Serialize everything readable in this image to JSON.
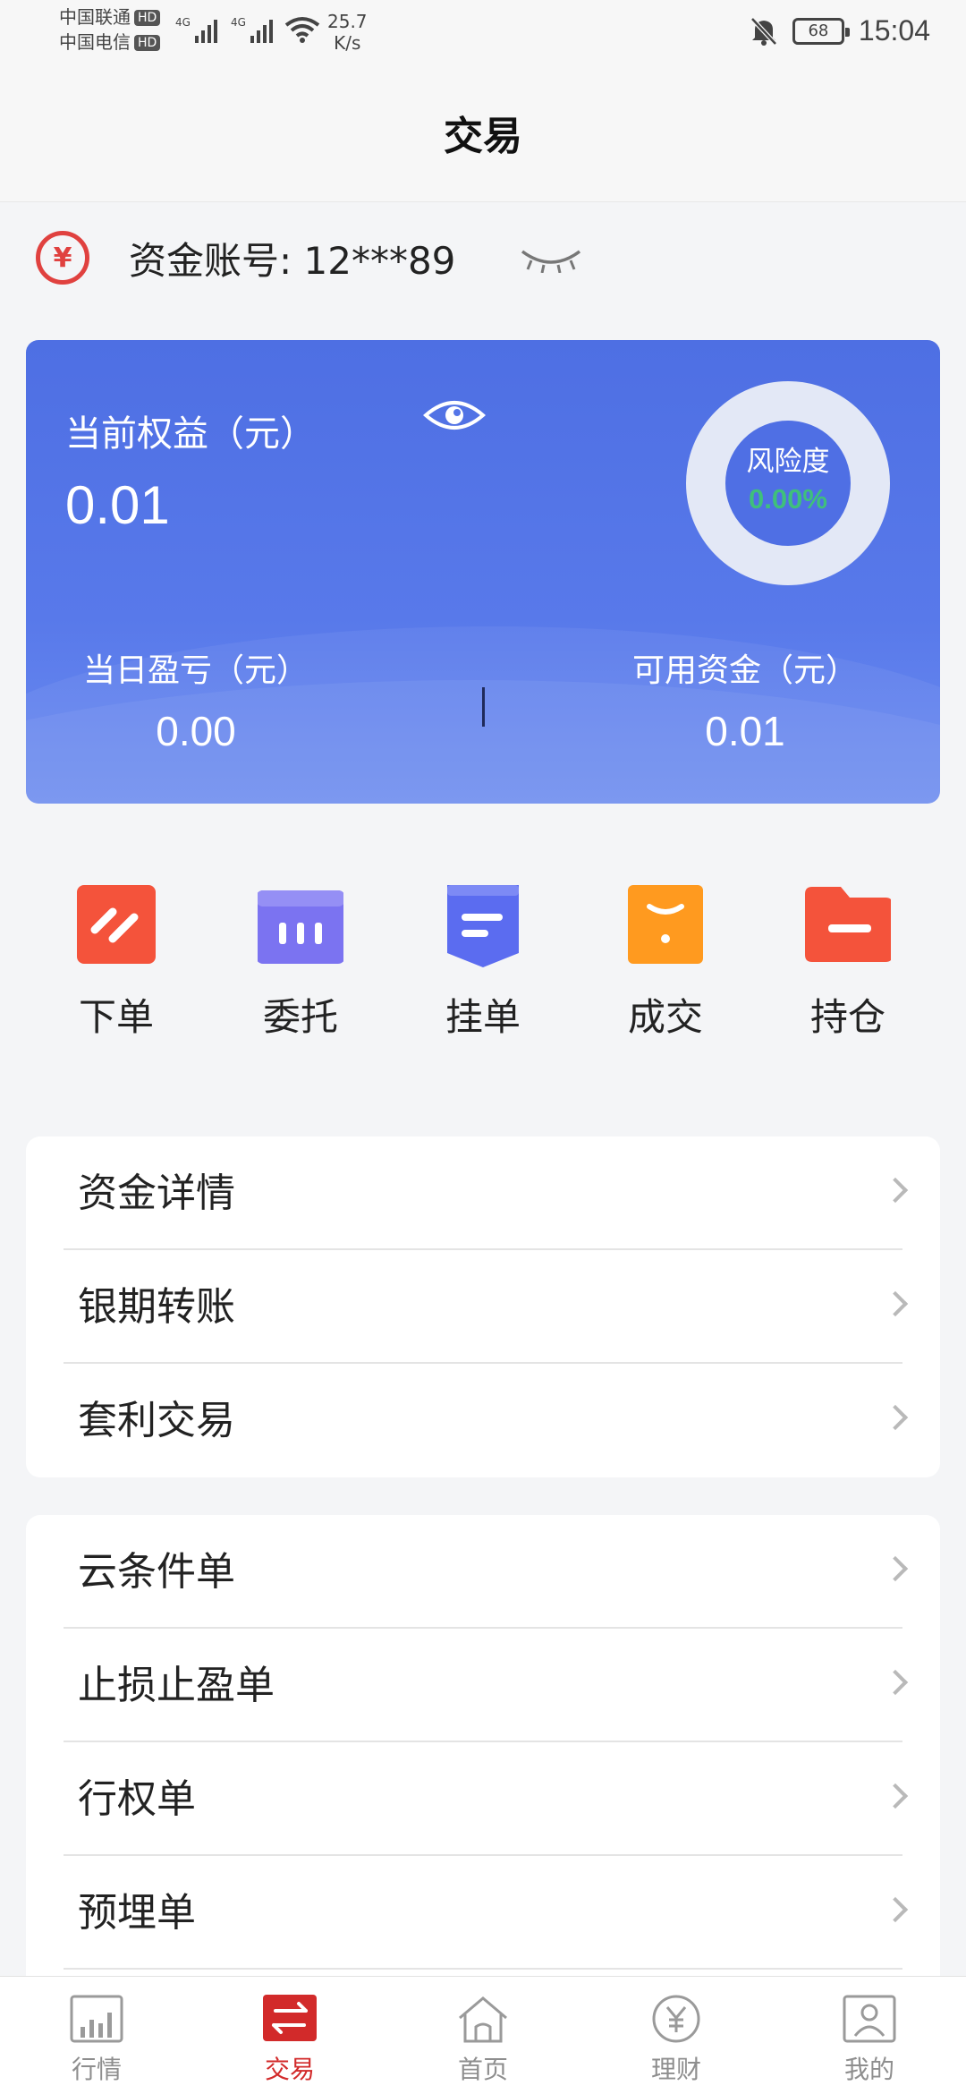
{
  "status_bar": {
    "carrier1": "中国联通",
    "carrier2": "中国电信",
    "hd": "HD",
    "net_label": "4G",
    "speed_value": "25.7",
    "speed_unit": "K/s",
    "battery": "68",
    "time": "15:04"
  },
  "header": {
    "title": "交易"
  },
  "account": {
    "label": "资金账号: 12***89",
    "yen_symbol": "¥"
  },
  "assets": {
    "equity_label": "当前权益（元）",
    "equity_value": "0.01",
    "risk_label": "风险度",
    "risk_value": "0.00%",
    "risk_fraction": 0,
    "daily_pl_label": "当日盈亏（元）",
    "daily_pl_value": "0.00",
    "available_label": "可用资金（元）",
    "available_value": "0.01",
    "colors": {
      "card": "#5475e8",
      "risk_green": "#3fc07b"
    }
  },
  "actions": [
    {
      "label": "下单",
      "icon": "place-order-icon",
      "color": "#f4533b"
    },
    {
      "label": "委托",
      "icon": "entrust-icon",
      "color": "#7b73f1"
    },
    {
      "label": "挂单",
      "icon": "pending-order-icon",
      "color": "#5b6cf0"
    },
    {
      "label": "成交",
      "icon": "deal-icon",
      "color": "#ff9a1f"
    },
    {
      "label": "持仓",
      "icon": "position-icon",
      "color": "#f4533b"
    }
  ],
  "menu_group1": [
    {
      "label": "资金详情"
    },
    {
      "label": "银期转账"
    },
    {
      "label": "套利交易"
    }
  ],
  "menu_group2": [
    {
      "label": "云条件单"
    },
    {
      "label": "止损止盈单"
    },
    {
      "label": "行权单"
    },
    {
      "label": "预埋单"
    }
  ],
  "tabbar": [
    {
      "label": "行情",
      "icon": "market-chart-icon"
    },
    {
      "label": "交易",
      "icon": "trade-exchange-icon",
      "active": true
    },
    {
      "label": "首页",
      "icon": "home-icon"
    },
    {
      "label": "理财",
      "icon": "finance-yen-icon"
    },
    {
      "label": "我的",
      "icon": "profile-icon"
    }
  ]
}
